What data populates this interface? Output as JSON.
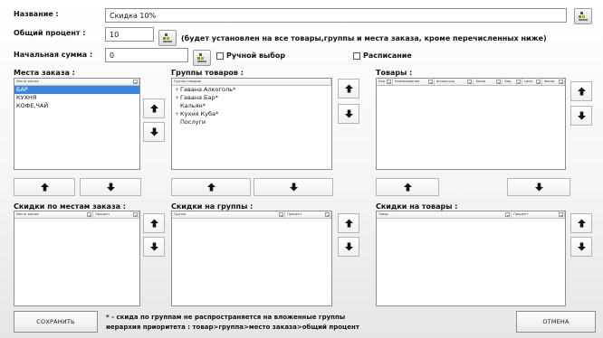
{
  "form": {
    "name_label": "Название :",
    "name_value": "Скидка 10%",
    "percent_label": "Общий процент :",
    "percent_value": "10",
    "percent_note": "(будет установлен на все товары,группы и места заказа, кроме перечисленных ниже)",
    "start_sum_label": "Начальная сумма :",
    "start_sum_value": "0",
    "manual_label": "Ручной выбор",
    "schedule_label": "Расписание"
  },
  "places": {
    "label": "Места заказа :",
    "column": "Места заказа",
    "items": [
      "БАР",
      "КУХНЯ",
      "КОФЕ,ЧАЙ"
    ],
    "selected_index": 0
  },
  "groups": {
    "label": "Группы товаров :",
    "column": "Группы товаров",
    "items": [
      {
        "label": "Гавана Алкоголь*",
        "expandable": "+"
      },
      {
        "label": "Гавана Бар*",
        "expandable": "+"
      },
      {
        "label": "Кальян*",
        "expandable": ""
      },
      {
        "label": "Кухня Куба*",
        "expandable": "+"
      },
      {
        "label": "Послуги",
        "expandable": ""
      }
    ]
  },
  "products": {
    "label": "Товары :",
    "columns": [
      "Код",
      "Наименование",
      "Штрих-код",
      "Весов",
      "Вид",
      "Цена",
      "Фасов"
    ]
  },
  "place_discounts": {
    "label": "Скидки по местам заказа :",
    "columns": [
      "Место заказа",
      "Процент"
    ]
  },
  "group_discounts": {
    "label": "Скидки на группы :",
    "columns": [
      "Группа",
      "Процент"
    ]
  },
  "product_discounts": {
    "label": "Скидки на товары :",
    "columns": [
      "Товар",
      "Процент"
    ]
  },
  "footer": {
    "save_label": "СОХРАНИТЬ",
    "cancel_label": "ОТМЕНА",
    "note_line1": "* - скида по группам не распространяется на вложенные группы",
    "note_line2": "иерархия приоритета : товар>группа>место заказа>общий процент"
  },
  "icons": {
    "calc": "calculator-icon",
    "up": "arrow-up-icon",
    "down": "arrow-down-icon"
  },
  "colors": {
    "selection": "#3b87e0",
    "border": "#8e8e8e"
  }
}
